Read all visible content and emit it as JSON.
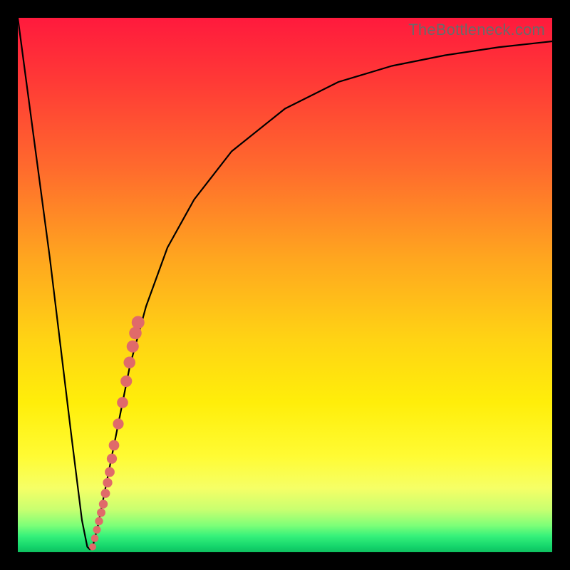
{
  "watermark": "TheBottleneck.com",
  "chart_data": {
    "type": "line",
    "title": "",
    "xlabel": "",
    "ylabel": "",
    "xlim": [
      0,
      100
    ],
    "ylim": [
      0,
      100
    ],
    "series": [
      {
        "name": "bottleneck-curve",
        "x": [
          0,
          6,
          10,
          12,
          13,
          13.5,
          14,
          15,
          17,
          19,
          21,
          24,
          28,
          33,
          40,
          50,
          60,
          70,
          80,
          90,
          100
        ],
        "values": [
          100,
          55,
          22,
          6,
          1,
          0.5,
          1,
          5,
          15,
          25,
          35,
          46,
          57,
          66,
          75,
          83,
          88,
          91,
          93,
          94.5,
          95.6
        ]
      }
    ],
    "markers": {
      "name": "highlight-dots",
      "color": "#e06a6a",
      "x": [
        14.0,
        14.4,
        14.8,
        15.2,
        15.6,
        16.0,
        16.4,
        16.8,
        17.2,
        17.6,
        18.0,
        18.8,
        19.6,
        20.3,
        20.9,
        21.5,
        22.0,
        22.5
      ],
      "values": [
        1.0,
        2.6,
        4.2,
        5.8,
        7.4,
        9.0,
        11.0,
        13.0,
        15.0,
        17.5,
        20.0,
        24.0,
        28.0,
        32.0,
        35.5,
        38.5,
        41.0,
        43.0
      ]
    }
  }
}
